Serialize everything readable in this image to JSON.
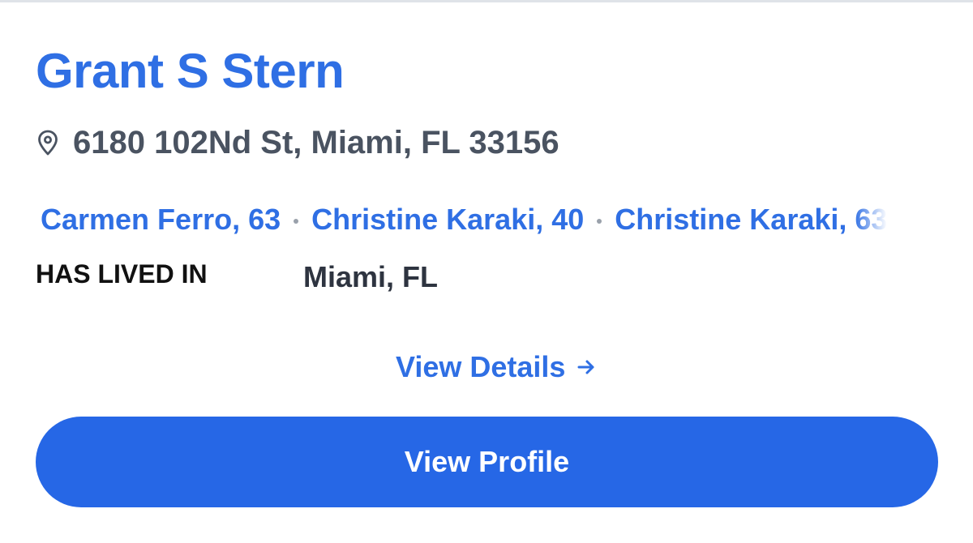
{
  "colors": {
    "accent": "#2f6fe4",
    "button": "#2667e6",
    "address_text": "#4a5361",
    "label_text": "#111111",
    "separator_dot": "#9aa1ab"
  },
  "person": {
    "name": "Grant S Stern",
    "address_icon": "map-pin-icon",
    "address": "6180 102Nd St, Miami, FL 33156"
  },
  "relatives": [
    {
      "label": "Carmen Ferro, 63"
    },
    {
      "label": "Christine Karaki, 40"
    },
    {
      "label": "Christine Karaki, 63"
    }
  ],
  "lived_in": {
    "label": "HAS LIVED IN",
    "value": "Miami, FL"
  },
  "actions": {
    "details_label": "View Details",
    "details_icon": "arrow-right-icon",
    "profile_label": "View Profile"
  }
}
